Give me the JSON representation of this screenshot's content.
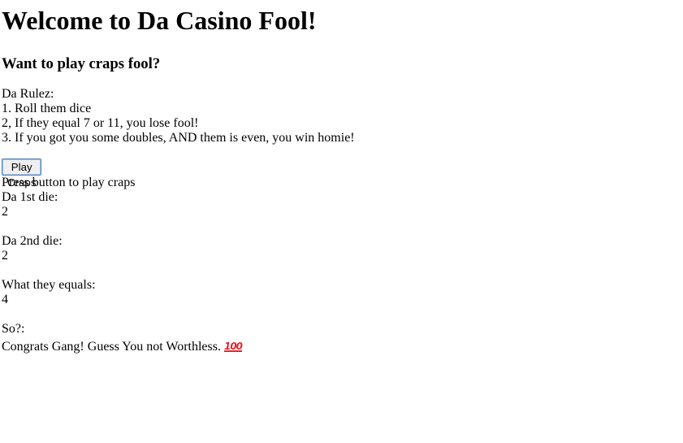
{
  "header": {
    "title": "Welcome to Da Casino Fool!",
    "subtitle": "Want to play craps fool?"
  },
  "rules": {
    "heading": "Da Rulez:",
    "items": [
      "1. Roll them dice",
      "2, If they equal 7 or 11, you lose fool!",
      "3. If you got you some doubles, AND them is even, you win homie!"
    ]
  },
  "controls": {
    "play_button_label": "Play Craps",
    "instruction": "Press button to play craps"
  },
  "results": {
    "die1_label": "Da 1st die:",
    "die1_value": "2",
    "die2_label": "Da 2nd die:",
    "die2_value": "2",
    "sum_label": "What they equals:",
    "sum_value": "4",
    "outcome_label": "So?:",
    "outcome_text": "Congrats Gang! Guess You not Worthless.",
    "outcome_emoji": "100"
  }
}
